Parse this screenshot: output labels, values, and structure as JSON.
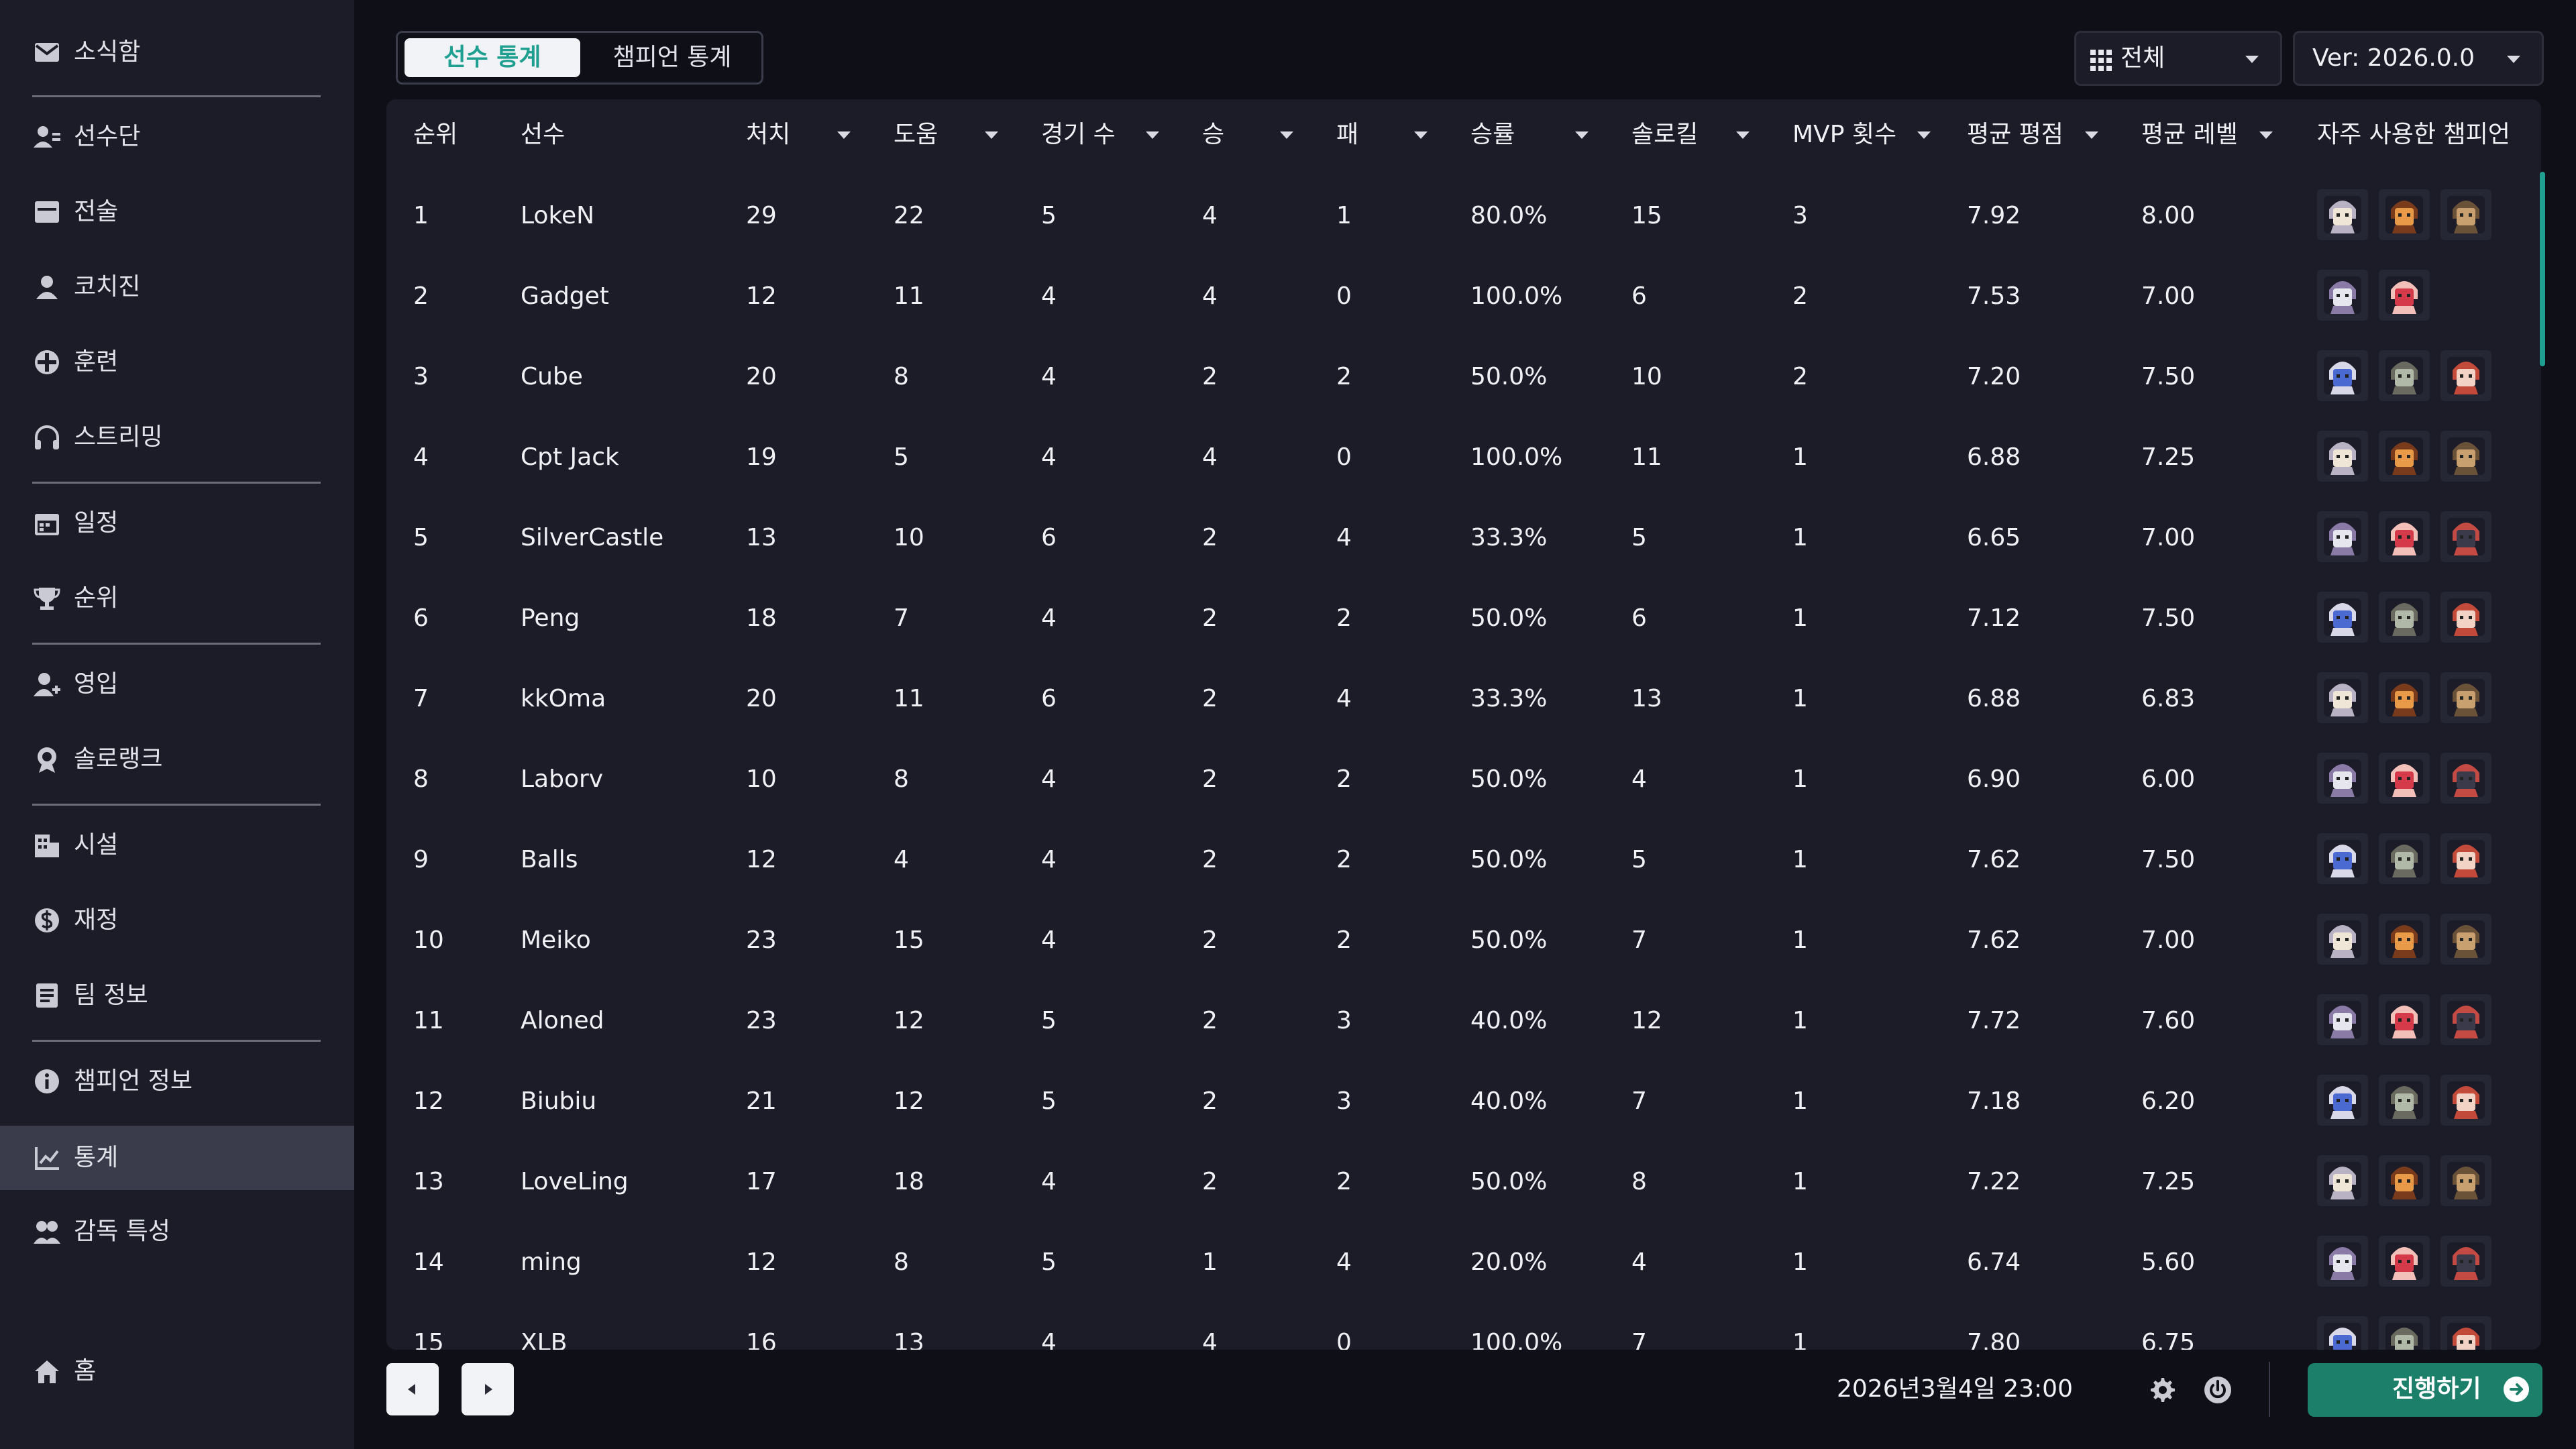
{
  "sidebar": {
    "items": [
      {
        "label": "소식함",
        "icon": "mail-icon",
        "name": "sidebar-item-inbox"
      },
      {
        "label": "선수단",
        "icon": "roster-icon",
        "name": "sidebar-item-roster"
      },
      {
        "label": "전술",
        "icon": "tactics-icon",
        "name": "sidebar-item-tactics"
      },
      {
        "label": "코치진",
        "icon": "coach-icon",
        "name": "sidebar-item-coaches"
      },
      {
        "label": "훈련",
        "icon": "training-icon",
        "name": "sidebar-item-training"
      },
      {
        "label": "스트리밍",
        "icon": "headphones-icon",
        "name": "sidebar-item-streaming"
      },
      {
        "label": "일정",
        "icon": "calendar-icon",
        "name": "sidebar-item-schedule"
      },
      {
        "label": "순위",
        "icon": "trophy-icon",
        "name": "sidebar-item-standings"
      },
      {
        "label": "영입",
        "icon": "add-user-icon",
        "name": "sidebar-item-recruit"
      },
      {
        "label": "솔로랭크",
        "icon": "medal-icon",
        "name": "sidebar-item-solorank"
      },
      {
        "label": "시설",
        "icon": "building-icon",
        "name": "sidebar-item-facilities"
      },
      {
        "label": "재정",
        "icon": "money-icon",
        "name": "sidebar-item-finance"
      },
      {
        "label": "팀 정보",
        "icon": "team-info-icon",
        "name": "sidebar-item-team-info"
      },
      {
        "label": "챔피언 정보",
        "icon": "info-icon",
        "name": "sidebar-item-champion-info"
      },
      {
        "label": "통계",
        "icon": "chart-line-icon",
        "name": "sidebar-item-statistics"
      },
      {
        "label": "감독 특성",
        "icon": "traits-icon",
        "name": "sidebar-item-manager-traits"
      },
      {
        "label": "홈",
        "icon": "home-icon",
        "name": "sidebar-item-home"
      }
    ],
    "active_label": "통계"
  },
  "tabs": {
    "player_stats": "선수 통계",
    "champion_stats": "챔피언 통계"
  },
  "filters": {
    "scope": {
      "value": "전체",
      "icon": "grid-icon"
    },
    "version": {
      "value": "Ver: 2026.0.0"
    }
  },
  "table": {
    "columns": [
      "순위",
      "선수",
      "처치",
      "도움",
      "경기 수",
      "승",
      "패",
      "승률",
      "솔로킬",
      "MVP 횟수",
      "평균 평점",
      "평균 레벨",
      "자주 사용한 챔피언"
    ],
    "rows": [
      [
        "1",
        "LokeN",
        "29",
        "22",
        "5",
        "4",
        "1",
        "80.0%",
        "15",
        "3",
        "7.92",
        "8.00"
      ],
      [
        "2",
        "Gadget",
        "12",
        "11",
        "4",
        "4",
        "0",
        "100.0%",
        "6",
        "2",
        "7.53",
        "7.00"
      ],
      [
        "3",
        "Cube",
        "20",
        "8",
        "4",
        "2",
        "2",
        "50.0%",
        "10",
        "2",
        "7.20",
        "7.50"
      ],
      [
        "4",
        "Cpt Jack",
        "19",
        "5",
        "4",
        "4",
        "0",
        "100.0%",
        "11",
        "1",
        "6.88",
        "7.25"
      ],
      [
        "5",
        "SilverCastle",
        "13",
        "10",
        "6",
        "2",
        "4",
        "33.3%",
        "5",
        "1",
        "6.65",
        "7.00"
      ],
      [
        "6",
        "Peng",
        "18",
        "7",
        "4",
        "2",
        "2",
        "50.0%",
        "6",
        "1",
        "7.12",
        "7.50"
      ],
      [
        "7",
        "kkOma",
        "20",
        "11",
        "6",
        "2",
        "4",
        "33.3%",
        "13",
        "1",
        "6.88",
        "6.83"
      ],
      [
        "8",
        "Laborv",
        "10",
        "8",
        "4",
        "2",
        "2",
        "50.0%",
        "4",
        "1",
        "6.90",
        "6.00"
      ],
      [
        "9",
        "Balls",
        "12",
        "4",
        "4",
        "2",
        "2",
        "50.0%",
        "5",
        "1",
        "7.62",
        "7.50"
      ],
      [
        "10",
        "Meiko",
        "23",
        "15",
        "4",
        "2",
        "2",
        "50.0%",
        "7",
        "1",
        "7.62",
        "7.00"
      ],
      [
        "11",
        "Aloned",
        "23",
        "12",
        "5",
        "2",
        "3",
        "40.0%",
        "12",
        "1",
        "7.72",
        "7.60"
      ],
      [
        "12",
        "Biubiu",
        "21",
        "12",
        "5",
        "2",
        "3",
        "40.0%",
        "7",
        "1",
        "7.18",
        "6.20"
      ],
      [
        "13",
        "LoveLing",
        "17",
        "18",
        "4",
        "2",
        "2",
        "50.0%",
        "8",
        "1",
        "7.22",
        "7.25"
      ],
      [
        "14",
        "ming",
        "12",
        "8",
        "5",
        "1",
        "4",
        "20.0%",
        "4",
        "1",
        "6.74",
        "5.60"
      ],
      [
        "15",
        "XLB",
        "16",
        "13",
        "4",
        "4",
        "0",
        "100.0%",
        "7",
        "1",
        "7.80",
        "6.75"
      ]
    ],
    "champion_counts": [
      3,
      2,
      3,
      3,
      3,
      3,
      3,
      3,
      3,
      3,
      3,
      3,
      3,
      3,
      3
    ]
  },
  "footer": {
    "prev_icon": "chevron-left-icon",
    "next_icon": "chevron-right-icon",
    "datetime": "2026년3월4일 23:00",
    "settings_icon": "gear-icon",
    "power_icon": "power-icon",
    "proceed_label": "진행하기",
    "proceed_icon": "arrow-right-circle-icon"
  },
  "colors": {
    "accent": "#1f9f90",
    "proceed": "#1b7f6a",
    "sidebar_bg": "#1b1c27",
    "page_bg": "#0f1017",
    "panel_bg": "#1b1c27"
  }
}
